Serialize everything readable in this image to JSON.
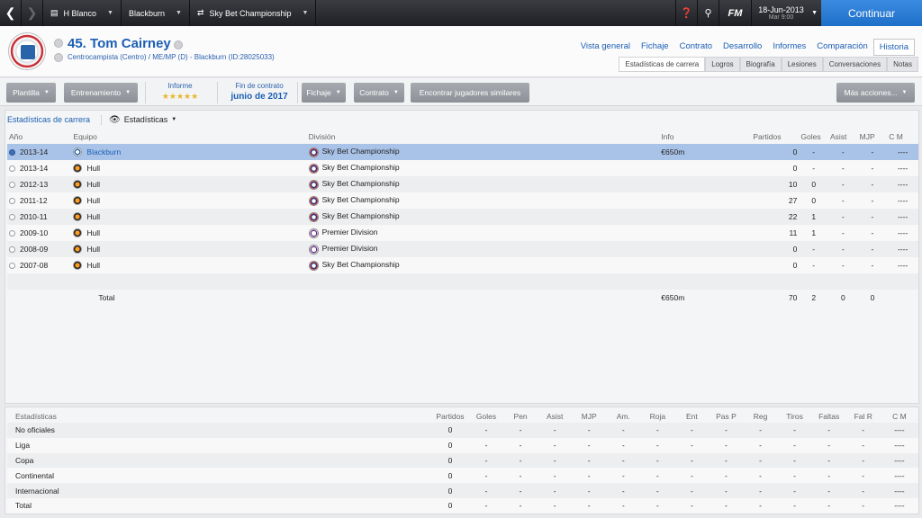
{
  "topbar": {
    "back_icon": "chevron-left-icon",
    "forward_icon": "chevron-right-icon",
    "manager": "H Blanco",
    "club": "Blackburn",
    "competition": "Sky Bet Championship",
    "date": "18-Jun-2013",
    "weekday": "Mar 9:00",
    "fm_label": "FM",
    "continue_label": "Continuar"
  },
  "player": {
    "name": "45. Tom Cairney",
    "subtitle": "Centrocampista (Centro) / ME/MP (D) - Blackburn (ID:28025033)"
  },
  "main_tabs": [
    "Vista general",
    "Fichaje",
    "Contrato",
    "Desarrollo",
    "Informes",
    "Comparación",
    "Historia"
  ],
  "sub_tabs": [
    "Estadísticas de carrera",
    "Logros",
    "Biografía",
    "Lesiones",
    "Conversaciones",
    "Notas"
  ],
  "toolbar": {
    "plantilla": "Plantilla",
    "entrenamiento": "Entrenamiento",
    "informe_label": "Informe",
    "informe_stars": "★★★★★",
    "contract_label": "Fin de contrato",
    "contract_value": "junio de 2017",
    "fichaje": "Fichaje",
    "contrato": "Contrato",
    "similar": "Encontrar jugadores similares",
    "more": "Más acciones..."
  },
  "career": {
    "panel_title": "Estadísticas de carrera",
    "view_label": "Estadísticas",
    "headers": {
      "year": "Año",
      "team": "Equipo",
      "division": "División",
      "info": "Info",
      "apps": "Partidos",
      "goals": "Goles",
      "assists": "Asist",
      "mjp": "MJP",
      "cm": "C M"
    },
    "rows": [
      {
        "year": "2013-14",
        "team": "Blackburn",
        "division": "Sky Bet Championship",
        "info": "€650m",
        "apps": "0",
        "goals": "-",
        "assists": "-",
        "mjp": "-",
        "cm": "----"
      },
      {
        "year": "2013-14",
        "team": "Hull",
        "division": "Sky Bet Championship",
        "info": "",
        "apps": "0",
        "goals": "-",
        "assists": "-",
        "mjp": "-",
        "cm": "----"
      },
      {
        "year": "2012-13",
        "team": "Hull",
        "division": "Sky Bet Championship",
        "info": "",
        "apps": "10",
        "goals": "0",
        "assists": "-",
        "mjp": "-",
        "cm": "----"
      },
      {
        "year": "2011-12",
        "team": "Hull",
        "division": "Sky Bet Championship",
        "info": "",
        "apps": "27",
        "goals": "0",
        "assists": "-",
        "mjp": "-",
        "cm": "----"
      },
      {
        "year": "2010-11",
        "team": "Hull",
        "division": "Sky Bet Championship",
        "info": "",
        "apps": "22",
        "goals": "1",
        "assists": "-",
        "mjp": "-",
        "cm": "----"
      },
      {
        "year": "2009-10",
        "team": "Hull",
        "division": "Premier Division",
        "info": "",
        "apps": "11",
        "goals": "1",
        "assists": "-",
        "mjp": "-",
        "cm": "----"
      },
      {
        "year": "2008-09",
        "team": "Hull",
        "division": "Premier Division",
        "info": "",
        "apps": "0",
        "goals": "-",
        "assists": "-",
        "mjp": "-",
        "cm": "----"
      },
      {
        "year": "2007-08",
        "team": "Hull",
        "division": "Sky Bet Championship",
        "info": "",
        "apps": "0",
        "goals": "-",
        "assists": "-",
        "mjp": "-",
        "cm": "----"
      }
    ],
    "total": {
      "label": "Total",
      "info": "€650m",
      "apps": "70",
      "goals": "2",
      "assists": "0",
      "mjp": "0"
    }
  },
  "stats": {
    "headers": [
      "Estadísticas",
      "Partidos",
      "Goles",
      "Pen",
      "Asist",
      "MJP",
      "Am.",
      "Roja",
      "Ent",
      "Pas P",
      "Reg",
      "Tiros",
      "Faltas",
      "Fal R",
      "C M"
    ],
    "rows": [
      [
        "No oficiales",
        "0",
        "-",
        "-",
        "-",
        "-",
        "-",
        "-",
        "-",
        "-",
        "-",
        "-",
        "-",
        "-",
        "----"
      ],
      [
        "Liga",
        "0",
        "-",
        "-",
        "-",
        "-",
        "-",
        "-",
        "-",
        "-",
        "-",
        "-",
        "-",
        "-",
        "----"
      ],
      [
        "Copa",
        "0",
        "-",
        "-",
        "-",
        "-",
        "-",
        "-",
        "-",
        "-",
        "-",
        "-",
        "-",
        "-",
        "----"
      ],
      [
        "Continental",
        "0",
        "-",
        "-",
        "-",
        "-",
        "-",
        "-",
        "-",
        "-",
        "-",
        "-",
        "-",
        "-",
        "----"
      ],
      [
        "Internacional",
        "0",
        "-",
        "-",
        "-",
        "-",
        "-",
        "-",
        "-",
        "-",
        "-",
        "-",
        "-",
        "-",
        "----"
      ],
      [
        "Total",
        "0",
        "-",
        "-",
        "-",
        "-",
        "-",
        "-",
        "-",
        "-",
        "-",
        "-",
        "-",
        "-",
        "----"
      ]
    ]
  }
}
